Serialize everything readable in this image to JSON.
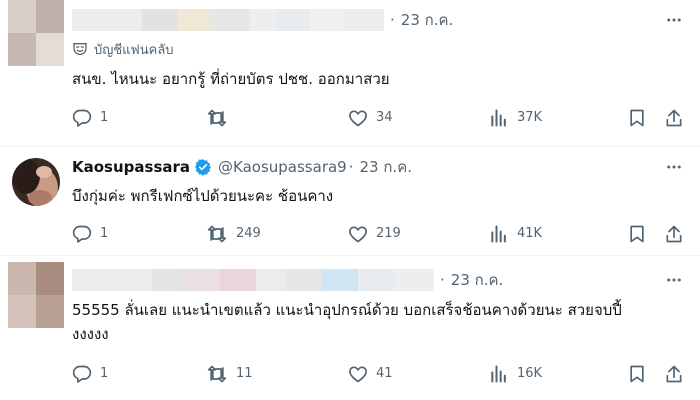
{
  "posts": [
    {
      "time": "23 ก.ค.",
      "badge_label": "บัญชีแฟนคลับ",
      "text": "สนข. ไหนนะ อยากรู้ ที่ถ่ายบัตร ปชช. ออกมาสวย",
      "replies": "1",
      "reposts": "",
      "likes": "34",
      "views": "37K"
    },
    {
      "display_name": "Kaosupassara",
      "handle": "@Kaosupassara9",
      "time": "23 ก.ค.",
      "text": "บึงกุ่มค่ะ พกรีเฟกซ์ไปด้วยนะคะ ช้อนคาง",
      "replies": "1",
      "reposts": "249",
      "likes": "219",
      "views": "41K"
    },
    {
      "time": "23 ก.ค.",
      "text_line1": "55555 ลั่นเลย แนะนำเขตแล้ว แนะนำอุปกรณ์ด้วย บอกเสร็จช้อนคางด้วยนะ สวยจบปี้",
      "text_line2": "งงงงง",
      "replies": "1",
      "reposts": "11",
      "likes": "41",
      "views": "16K"
    }
  ],
  "separator": "·",
  "colors": {
    "text": "#0f1419",
    "secondary": "#536471",
    "border": "#eff3f4",
    "verified": "#1d9bf0"
  },
  "icons": [
    "reply-icon",
    "repost-icon",
    "like-icon",
    "views-icon",
    "bookmark-icon",
    "share-icon",
    "more-icon",
    "verified-badge-icon",
    "fanclub-mask-icon"
  ]
}
